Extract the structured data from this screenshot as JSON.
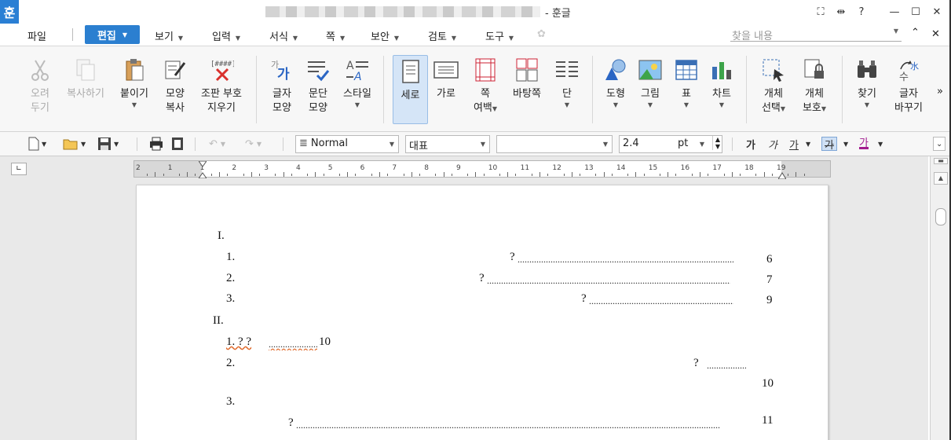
{
  "app": {
    "icon_label": "훈",
    "title": "- 훈글"
  },
  "window_controls": {
    "fullscreen": "⛶",
    "split": "⇹",
    "help": "?",
    "minimize": "—",
    "maximize": "☐",
    "close": "✕"
  },
  "menu": {
    "file": "파일",
    "active": "편집",
    "items": [
      {
        "label": "보기"
      },
      {
        "label": "입력"
      },
      {
        "label": "서식"
      },
      {
        "label": "쪽"
      },
      {
        "label": "보안"
      },
      {
        "label": "검토"
      },
      {
        "label": "도구"
      }
    ],
    "search_placeholder": "찾을 내용",
    "collapse": "⌃",
    "close": "✕"
  },
  "ribbon": {
    "cut": [
      "오려",
      "두기"
    ],
    "copy": "복사하기",
    "paste": "붙이기",
    "format_copy": [
      "모양",
      "복사"
    ],
    "clear_marks": [
      "조판 부호",
      "지우기"
    ],
    "char_shape": [
      "글자",
      "모양"
    ],
    "para_shape": [
      "문단",
      "모양"
    ],
    "style": "스타일",
    "portrait": "세로",
    "landscape": "가로",
    "page_margin": [
      "쪽",
      "여백"
    ],
    "background_page": "바탕쪽",
    "columns": "단",
    "shape": "도형",
    "picture": "그림",
    "table": "표",
    "chart": "차트",
    "object_select": [
      "개체",
      "선택"
    ],
    "object_protect": [
      "개체",
      "보호"
    ],
    "find": "찾기",
    "replace": [
      "글자",
      "바꾸기"
    ],
    "more": "»"
  },
  "format_bar": {
    "style_value": "Normal",
    "font_lang_value": "대표",
    "font_name_value": "",
    "font_size_value": "2.4",
    "font_size_unit": "pt",
    "bold": "가",
    "italic": "가",
    "underline": "가",
    "strike": "가",
    "color": "가"
  },
  "ruler": {
    "ticks": [
      "2",
      "1",
      "1",
      "2",
      "3",
      "4",
      "5",
      "6",
      "7",
      "8",
      "9",
      "10",
      "11",
      "12",
      "13",
      "14",
      "15",
      "16",
      "17",
      "18",
      "19"
    ]
  },
  "document": {
    "lines": [
      {
        "text": "I."
      },
      {
        "text": "1."
      },
      {
        "text": "?"
      },
      {
        "text": "6"
      },
      {
        "text": "2."
      },
      {
        "text": "?"
      },
      {
        "text": "7"
      },
      {
        "text": "3."
      },
      {
        "text": "?"
      },
      {
        "text": "9"
      },
      {
        "text": "II."
      },
      {
        "text": "1.  ?  ?"
      },
      {
        "text": "10"
      },
      {
        "text": "2."
      },
      {
        "text": "?"
      },
      {
        "text": "10"
      },
      {
        "text": "3."
      },
      {
        "text": "?"
      },
      {
        "text": "11"
      }
    ]
  }
}
